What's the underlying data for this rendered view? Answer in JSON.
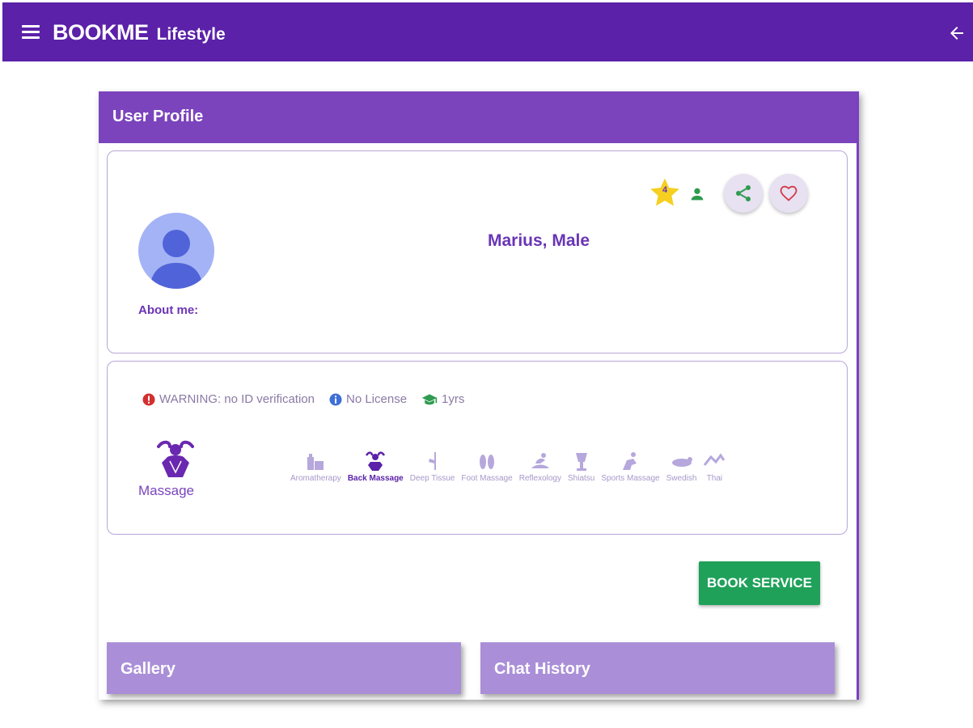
{
  "appbar": {
    "brand": "BOOKME",
    "brand_sub": "Lifestyle"
  },
  "profile": {
    "header": "User Profile",
    "name_line": "Marius, Male",
    "about_label": "About me:",
    "rating": "4"
  },
  "badges": [
    {
      "text": "WARNING: no ID verification",
      "icon": "error-icon",
      "color": "#d32f2f"
    },
    {
      "text": "No License",
      "icon": "info-icon",
      "color": "#3f6fd8"
    },
    {
      "text": "1yrs",
      "icon": "graduation-cap-icon",
      "color": "#2e9b4f"
    }
  ],
  "category": {
    "label": "Massage",
    "icon": "massage-icon"
  },
  "services": [
    {
      "label": "Aromatherapy",
      "active": false
    },
    {
      "label": "Back Massage",
      "active": true
    },
    {
      "label": "Deep Tissue",
      "active": false
    },
    {
      "label": "Foot Massage",
      "active": false
    },
    {
      "label": "Reflexology",
      "active": false
    },
    {
      "label": "Shiatsu",
      "active": false
    },
    {
      "label": "Sports Massage",
      "active": false
    },
    {
      "label": "Swedish",
      "active": false
    },
    {
      "label": "Thai",
      "active": false
    }
  ],
  "actions": {
    "book_label": "BOOK SERVICE"
  },
  "sections": {
    "gallery": "Gallery",
    "chat_history": "Chat History"
  },
  "colors": {
    "appbar": "#5b21a8",
    "header": "#7b44bd",
    "accent": "#6a35b5",
    "book": "#20a15a",
    "subcard": "#aa8fd8"
  }
}
